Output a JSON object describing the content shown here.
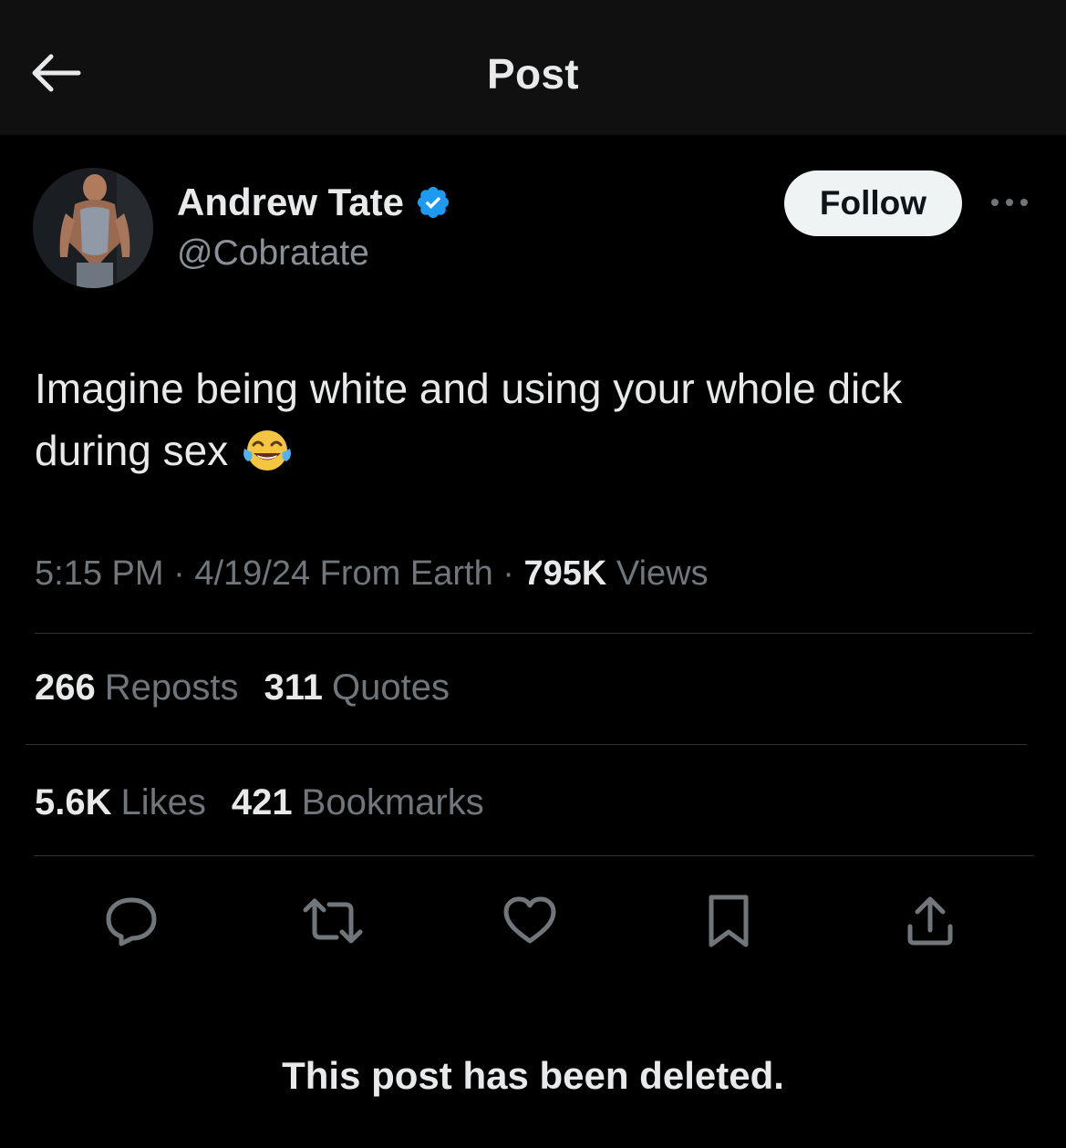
{
  "header": {
    "title": "Post",
    "back_icon": "arrow-left-icon"
  },
  "author": {
    "name": "Andrew Tate",
    "handle": "@Cobratate",
    "verified": true,
    "verified_color": "#1d9bf0"
  },
  "follow_button": {
    "label": "Follow"
  },
  "more_icon": "ellipsis-icon",
  "post": {
    "text_line1": "Imagine being white and using your whole dick",
    "text_line2": "during sex",
    "emoji": "face-with-tears-of-joy"
  },
  "meta": {
    "time": "5:15 PM",
    "date": "4/19/24",
    "location": "From Earth",
    "separator": "·",
    "views_count": "795K",
    "views_label": "Views"
  },
  "stats": {
    "reposts_count": "266",
    "reposts_label": "Reposts",
    "quotes_count": "311",
    "quotes_label": "Quotes",
    "likes_count": "5.6K",
    "likes_label": "Likes",
    "bookmarks_count": "421",
    "bookmarks_label": "Bookmarks"
  },
  "actions": [
    "reply-icon",
    "repost-icon",
    "like-icon",
    "bookmark-icon",
    "share-icon"
  ],
  "deleted_notice": "This post has been deleted.",
  "colors": {
    "background": "#000000",
    "header_background": "#101010",
    "primary_text": "#e7e9ea",
    "secondary_text": "#71767b",
    "divider": "#2f3336",
    "follow_button_bg": "#eff3f4"
  }
}
